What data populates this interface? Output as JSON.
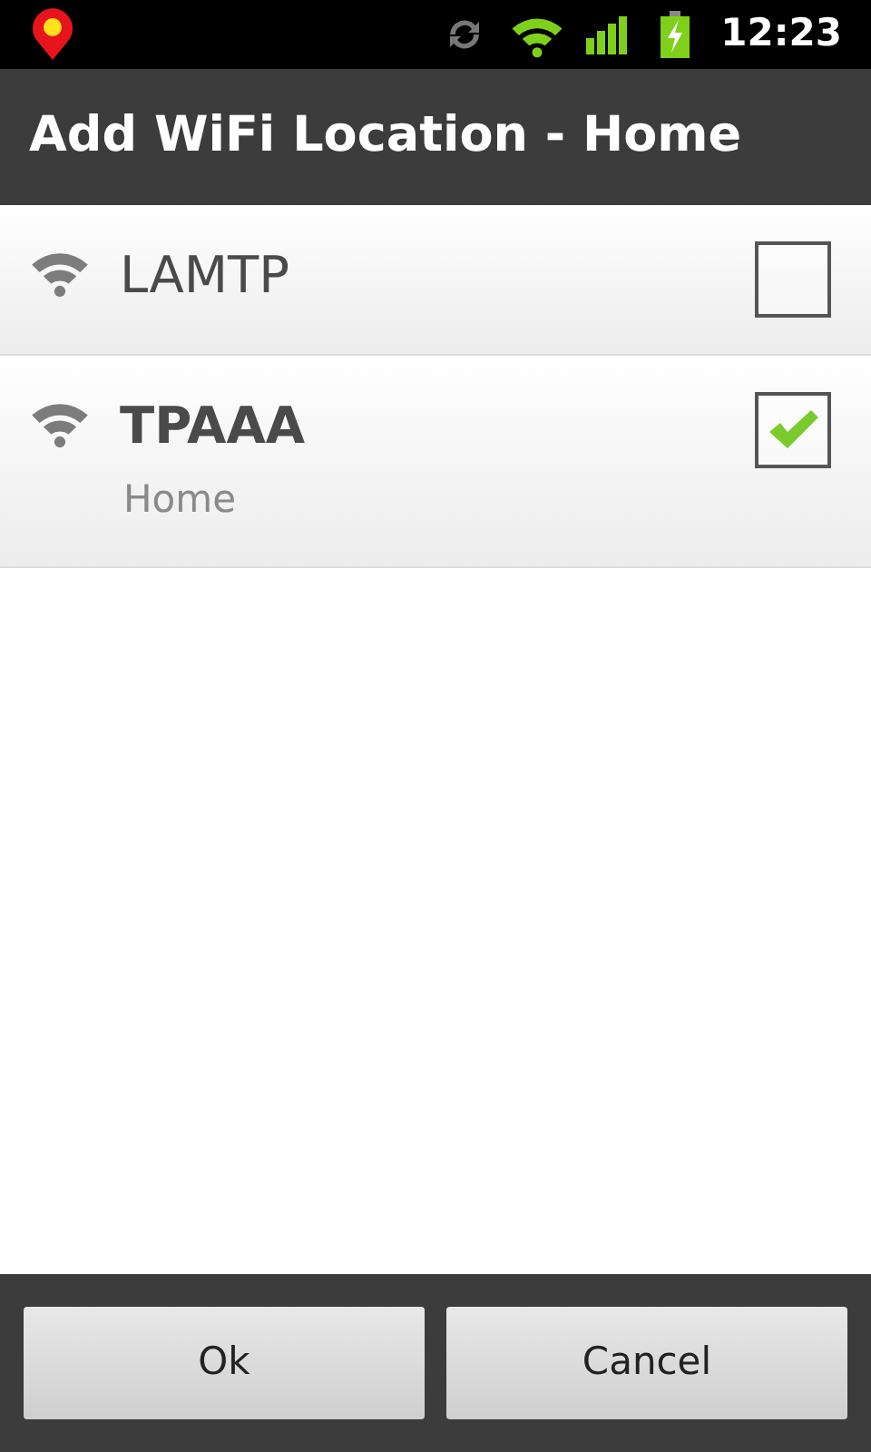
{
  "status_bar": {
    "time": "12:23"
  },
  "title": "Add WiFi Location - Home",
  "networks": [
    {
      "name": "LAMTP",
      "checked": false
    },
    {
      "name": "TPAAA",
      "checked": true,
      "subtitle": "Home"
    }
  ],
  "buttons": [
    "Ok",
    "Cancel"
  ]
}
